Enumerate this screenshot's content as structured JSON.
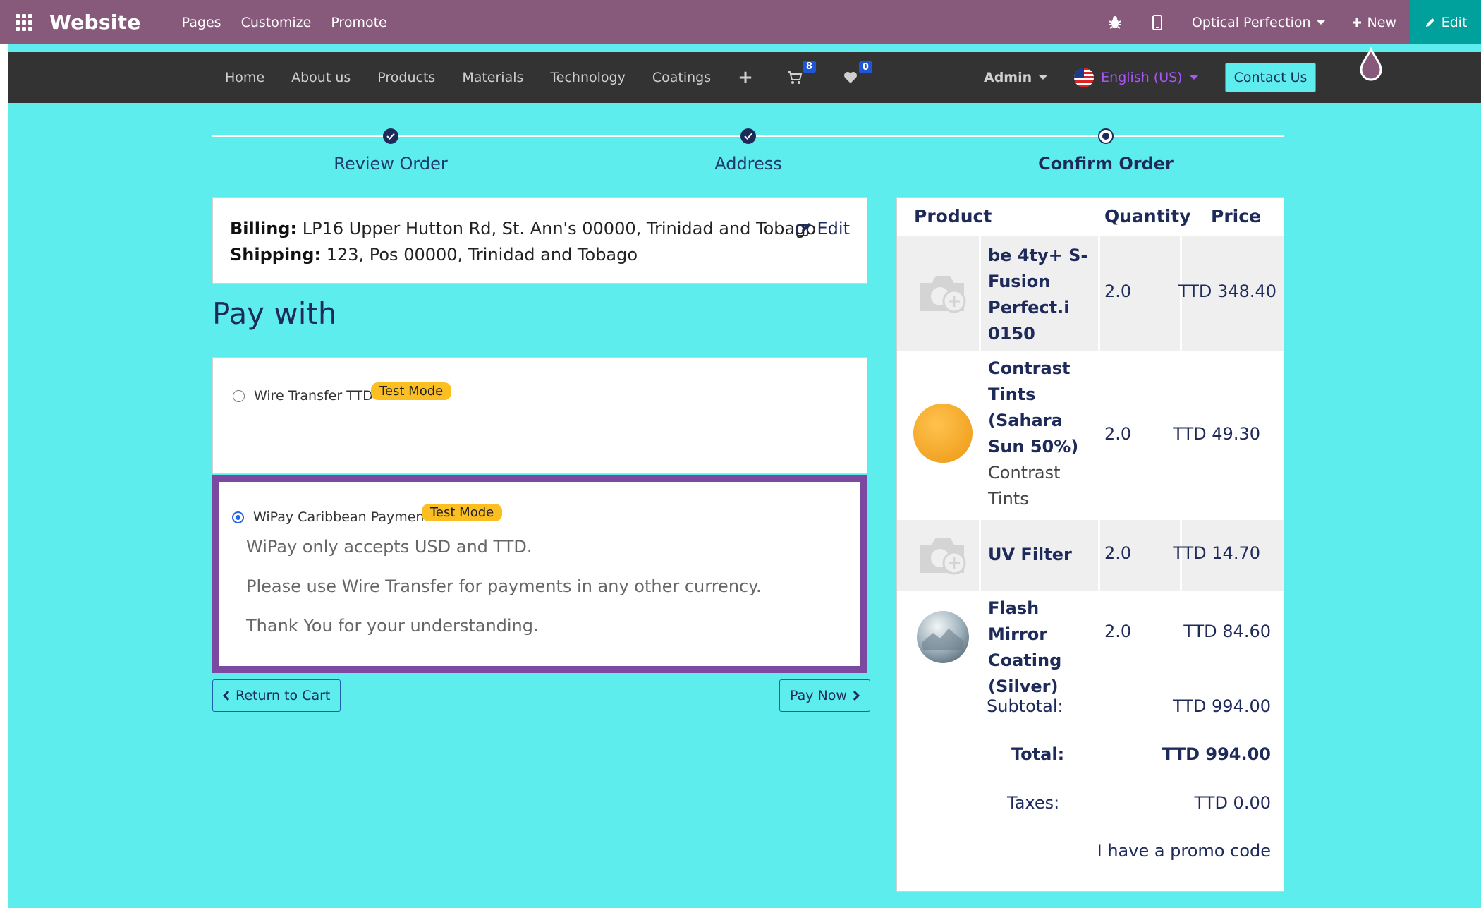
{
  "admin_bar": {
    "brand": "Website",
    "menu": [
      "Pages",
      "Customize",
      "Promote"
    ],
    "company": "Optical Perfection",
    "new_label": "New",
    "edit_label": "Edit",
    "icons": [
      "apps-icon",
      "bug-icon",
      "mobile-preview-icon",
      "plus-icon",
      "pencil-icon"
    ]
  },
  "site_nav": {
    "links": [
      "Home",
      "About us",
      "Products",
      "Materials",
      "Technology",
      "Coatings"
    ],
    "cart_count": "8",
    "wishlist_count": "0",
    "user": "Admin",
    "language": "English (US)",
    "contact_label": "Contact Us"
  },
  "steps": [
    {
      "label": "Review Order",
      "state": "done"
    },
    {
      "label": "Address",
      "state": "done"
    },
    {
      "label": "Confirm Order",
      "state": "current"
    }
  ],
  "address": {
    "billing_label": "Billing:",
    "billing": "LP16 Upper Hutton Rd, St. Ann's 00000, Trinidad and Tobago",
    "shipping_label": "Shipping:",
    "shipping": "123, Pos 00000, Trinidad and Tobago",
    "edit_label": "Edit"
  },
  "pay_with": {
    "title": "Pay with",
    "options": [
      {
        "name": "Wire Transfer TTD",
        "badge": "Test Mode",
        "selected": false
      },
      {
        "name": "WiPay Caribbean Payment",
        "badge": "Test Mode",
        "selected": true,
        "messages": [
          "WiPay only accepts USD and TTD.",
          "Please use Wire Transfer for payments in any other currency.",
          "Thank You for your understanding."
        ]
      }
    ],
    "return_label": "Return to Cart",
    "pay_label": "Pay Now"
  },
  "summary": {
    "headers": [
      "Product",
      "Quantity",
      "Price"
    ],
    "products": [
      {
        "name": "be 4ty+ S-Fusion Perfect.i 0150",
        "desc": "",
        "qty": "2.0",
        "price": "TTD 348.40",
        "image": "placeholder-camera-icon"
      },
      {
        "name": "Contrast Tints (Sahara Sun 50%)",
        "desc": "Contrast Tints",
        "qty": "2.0",
        "price": "TTD 49.30",
        "image": "orange-lens"
      },
      {
        "name": "UV Filter",
        "desc": "",
        "qty": "2.0",
        "price": "TTD 14.70",
        "image": "placeholder-camera-icon"
      },
      {
        "name": "Flash Mirror Coating (Silver)",
        "desc": "",
        "qty": "2.0",
        "price": "TTD 84.60",
        "image": "silver-mirror-lens"
      }
    ],
    "subtotal_label": "Subtotal:",
    "subtotal": "TTD 994.00",
    "total_label": "Total:",
    "total": "TTD 994.00",
    "taxes_label": "Taxes:",
    "taxes": "TTD 0.00",
    "promo_label": "I have a promo code"
  },
  "colors": {
    "admin_bar": "#875a7b",
    "edit_button": "#00a09d",
    "site_bg": "#5eeded",
    "nav_bg": "#333333",
    "selected_border": "#7b4aa0",
    "badge": "#fbbf24"
  }
}
